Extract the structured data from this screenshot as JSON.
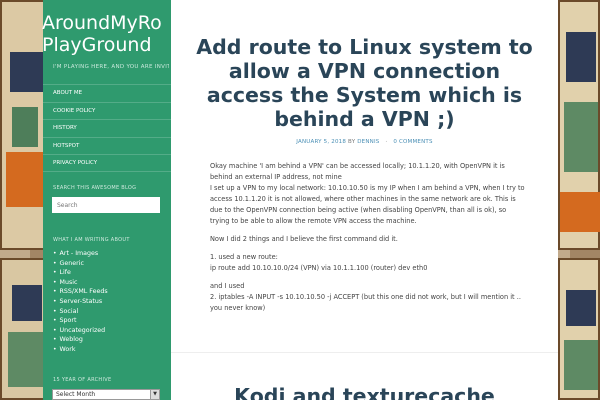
{
  "site": {
    "title_line1": "AroundMyRo",
    "title_line2": "PlayGround",
    "tagline": "I'M PLAYING HERE, AND YOU ARE INVITED"
  },
  "nav": {
    "items": [
      {
        "label": "ABOUT ME"
      },
      {
        "label": "COOKIE POLICY"
      },
      {
        "label": "HISTORY"
      },
      {
        "label": "HOTSPOT"
      },
      {
        "label": "PRIVACY POLICY"
      }
    ]
  },
  "search_widget": {
    "title": "SEARCH THIS AWESOME BLOG",
    "placeholder": "Search"
  },
  "categories_widget": {
    "title": "WHAT I AM WRITING ABOUT",
    "items": [
      "Art - Images",
      "Generic",
      "Life",
      "Music",
      "RSS/XML Feeds",
      "Server-Status",
      "Social",
      "Sport",
      "Uncategorized",
      "Weblog",
      "Work"
    ]
  },
  "archive_widget": {
    "title": "15 YEAR OF ARCHIVE",
    "selected": "Select Month"
  },
  "post": {
    "title": "Add route to Linux system to allow a VPN connection access the System which is behind a VPN ;)",
    "date": "JANUARY 5, 2018",
    "by": "BY",
    "author": "DENNIS",
    "comments": "0 COMMENTS",
    "paragraphs": [
      "Okay machine 'I am behind a VPN' can be accessed locally; 10.1.1.20, with OpenVPN it is behind an external IP address, not mine",
      "I set up a VPN to my local network: 10.10.10.50 is my IP when I am behind a VPN, when I try to access 10.1.1.20 it is not allowed, where other machines in the same network are ok. This is due to the OpenVPN connection being active (when disabling OpenVPN, than all is ok), so trying to be able to allow the remote VPN access the machine.",
      "Now I did 2 things and I believe the first command did it.",
      "1. used a new route:\nip route add 10.10.10.0/24 (VPN) via 10.1.1.100 (router) dev eth0",
      "and I used\n2. iptables -A INPUT -s 10.10.10.50 -j ACCEPT (but this one did not work, but I will mention it .. you never know)"
    ]
  },
  "next_post": {
    "title": "Kodi and texturecache"
  }
}
